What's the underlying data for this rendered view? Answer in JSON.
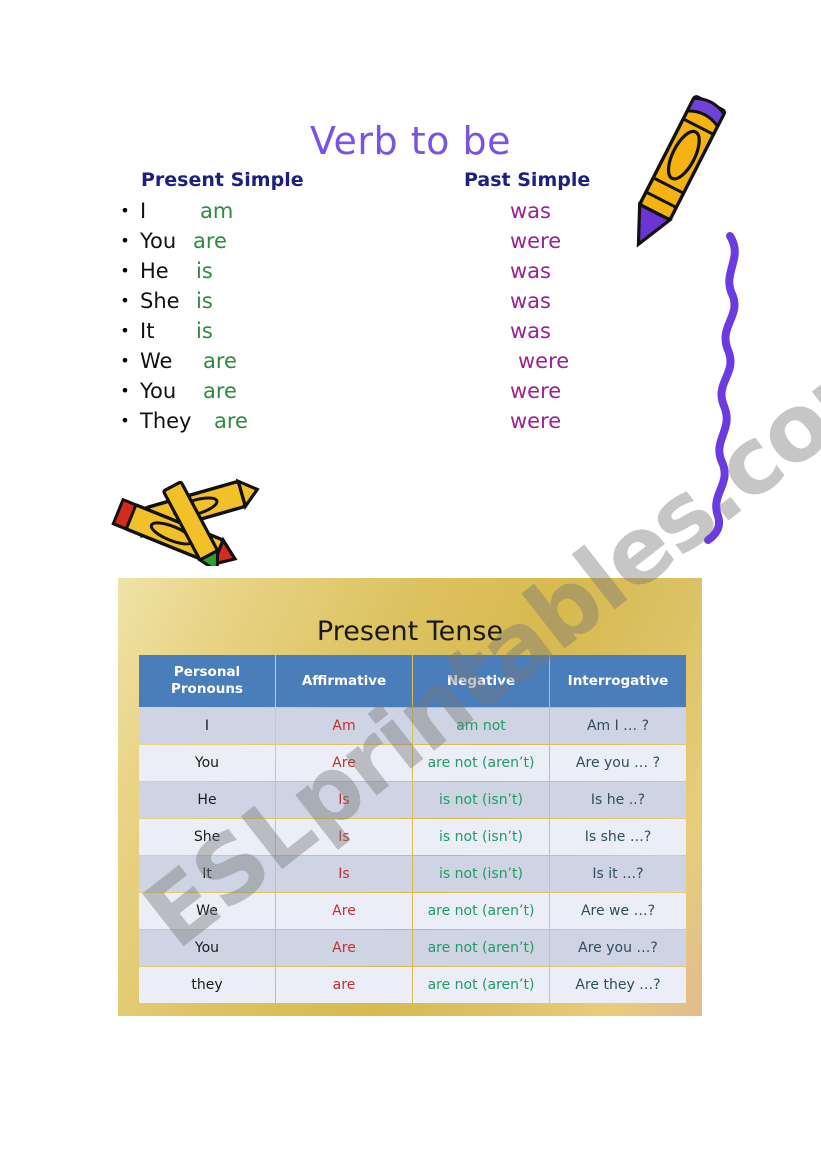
{
  "page": {
    "title": "Verb to be",
    "title_color": "#7B52E8",
    "background": "#ffffff"
  },
  "conjugation": {
    "heading_present": "Present Simple",
    "heading_past": "Past Simple",
    "heading_color": "#1E2080",
    "bullet": "•",
    "present_color": "#2E8B3C",
    "past_color": "#9B2193",
    "rows": [
      {
        "bullet": "•",
        "pronoun": "I",
        "present": "am",
        "past": "was"
      },
      {
        "bullet": "•",
        "pronoun": "You",
        "present": "are",
        "past": "were"
      },
      {
        "bullet": "•",
        "pronoun": "He",
        "present": "is",
        "past": "was"
      },
      {
        "bullet": "•",
        "pronoun": "She",
        "present": "is",
        "past": "was"
      },
      {
        "bullet": "•",
        "pronoun": "It",
        "present": "is",
        "past": "was"
      },
      {
        "bullet": "•",
        "pronoun": "We",
        "present": "are",
        "past": "were"
      },
      {
        "bullet": "•",
        "pronoun": "You",
        "present": "are",
        "past": "were"
      },
      {
        "bullet": "•",
        "pronoun": "They",
        "present": "are",
        "past": "were"
      }
    ]
  },
  "table_panel": {
    "title": "Present Tense",
    "panel_color": "#D7B94F",
    "header_color": "#4A7EBB",
    "columns": [
      "Personal Pronouns",
      "Affirmative",
      "Negative",
      "Interrogative"
    ],
    "column_lines": [
      [
        "Personal",
        "Pronouns"
      ],
      [
        "Affirmative"
      ],
      [
        "Negative"
      ],
      [
        "Interrogative"
      ]
    ],
    "affirmative_color": "#C23030",
    "negative_color": "#1F9B63",
    "interrogative_color": "#2D4E5E",
    "rows": [
      {
        "pronoun": "I",
        "affirmative": "Am",
        "negative": "am not",
        "interrogative": "Am I … ?"
      },
      {
        "pronoun": "You",
        "affirmative": "Are",
        "negative": "are not (aren’t)",
        "interrogative": "Are you … ?"
      },
      {
        "pronoun": "He",
        "affirmative": "Is",
        "negative": "is not (isn’t)",
        "interrogative": "Is he ..?"
      },
      {
        "pronoun": "She",
        "affirmative": "Is",
        "negative": "is not (isn’t)",
        "interrogative": "Is she …?"
      },
      {
        "pronoun": "It",
        "affirmative": "Is",
        "negative": "is not (isn’t)",
        "interrogative": "Is it …?"
      },
      {
        "pronoun": "We",
        "affirmative": "Are",
        "negative": "are not (aren’t)",
        "interrogative": "Are we …?"
      },
      {
        "pronoun": "You",
        "affirmative": "Are",
        "negative": "are not (aren’t)",
        "interrogative": "Are you …?"
      },
      {
        "pronoun": "they",
        "affirmative": "are",
        "negative": "are not (aren’t)",
        "interrogative": "Are they …?"
      }
    ]
  },
  "clipart": {
    "crayon_top_right": "yellow-crayon-purple-tip",
    "squiggle": "purple-wavy-line",
    "crayons_bottom_left": "two-crossed-crayons-green-red"
  },
  "watermark": {
    "text": "ESLprintables.com",
    "color": "rgba(120,120,120,0.42)"
  }
}
